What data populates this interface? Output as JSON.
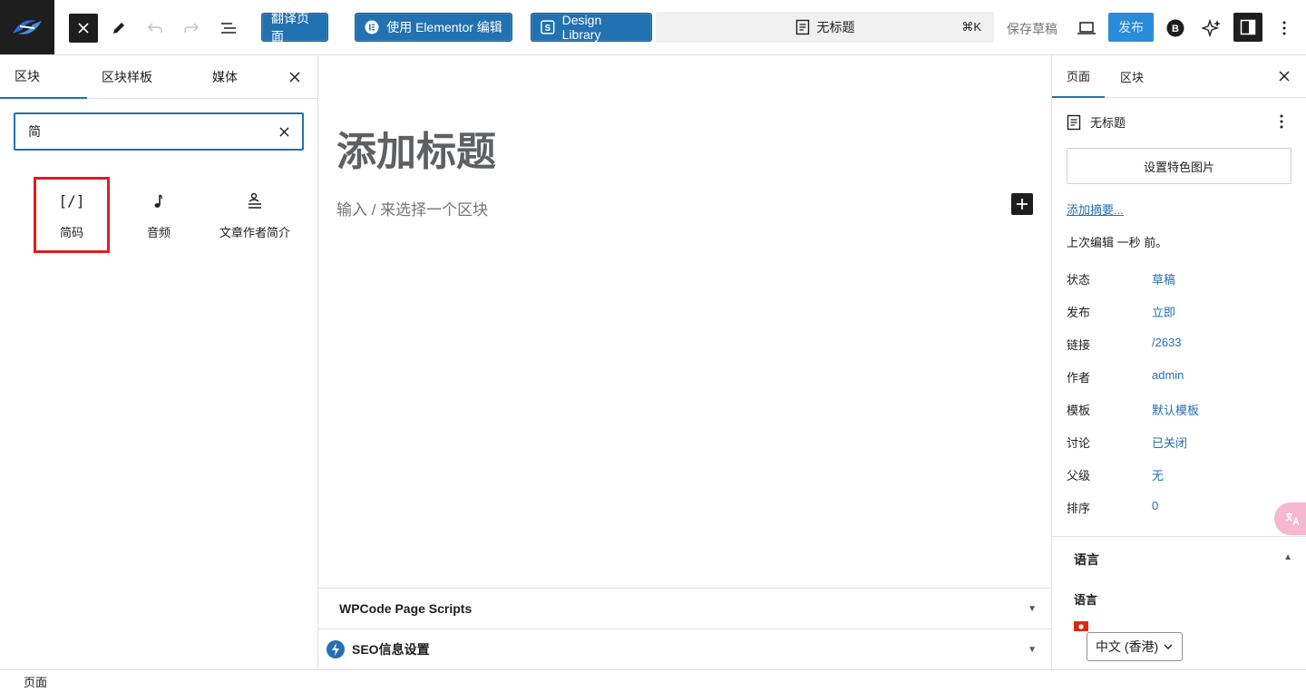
{
  "toolbar": {
    "translate_page_label": "翻译页面",
    "elementor_label": "使用 Elementor 编辑",
    "design_library_label": "Design Library",
    "doc_title": "无标题",
    "shortcut": "⌘K",
    "save_draft_label": "保存草稿",
    "publish_label": "发布"
  },
  "inserter": {
    "tabs": [
      "区块",
      "区块样板",
      "媒体"
    ],
    "active_tab": "区块",
    "search": {
      "value": "简",
      "placeholder": ""
    },
    "results": [
      {
        "label": "简码",
        "icon": "shortcode-icon",
        "glyph": "[/]",
        "highlighted": true
      },
      {
        "label": "音频",
        "icon": "audio-icon",
        "glyph": "♪",
        "highlighted": false
      },
      {
        "label": "文章作者简介",
        "icon": "author-bio-icon",
        "glyph": "",
        "highlighted": false
      }
    ]
  },
  "editor": {
    "title_placeholder": "添加标题",
    "block_placeholder": "输入 / 来选择一个区块",
    "meta_boxes": [
      {
        "label": "WPCode Page Scripts"
      },
      {
        "label": "SEO信息设置"
      }
    ]
  },
  "sidebar": {
    "tabs": [
      "页面",
      "区块"
    ],
    "active_tab": "页面",
    "doc_title": "无标题",
    "featured_image_label": "设置特色图片",
    "excerpt_link": "添加摘要...",
    "last_edited": "上次编辑 一秒 前。",
    "meta": [
      {
        "key": "状态",
        "value": "草稿"
      },
      {
        "key": "发布",
        "value": "立即"
      },
      {
        "key": "链接",
        "value": "/2633"
      },
      {
        "key": "作者",
        "value": "admin"
      },
      {
        "key": "模板",
        "value": "默认模板"
      },
      {
        "key": "讨论",
        "value": "已关闭"
      },
      {
        "key": "父级",
        "value": "无"
      },
      {
        "key": "排序",
        "value": "0"
      }
    ],
    "language_panel_title": "语言",
    "language_label": "语言",
    "language_selected": "中文 (香港)"
  },
  "footer": {
    "breadcrumb": "页面"
  },
  "colors": {
    "accent": "#2271b1",
    "publish": "#2a8bd8",
    "highlight": "#e01b24",
    "dark": "#1e1e1e"
  }
}
